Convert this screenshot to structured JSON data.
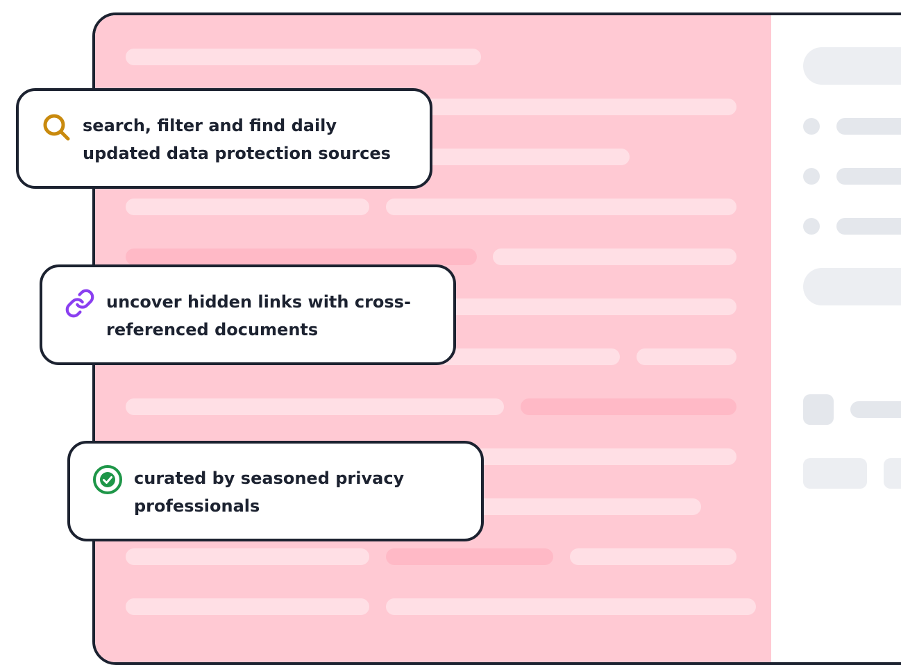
{
  "features": [
    {
      "icon": "search-icon",
      "text": "search, filter and find daily updated data protection sources",
      "color": "#c98a0e"
    },
    {
      "icon": "link-icon",
      "text": "uncover hidden links with cross-referenced documents",
      "color": "#8a3ff0"
    },
    {
      "icon": "check-circle-icon",
      "text": "curated by seasoned privacy professionals",
      "color": "#1e9648"
    }
  ],
  "colors": {
    "outline": "#1c2230",
    "document_background": "#ffc9d3",
    "highlight": "#ffb9c6",
    "skeleton": "#eceef2"
  }
}
